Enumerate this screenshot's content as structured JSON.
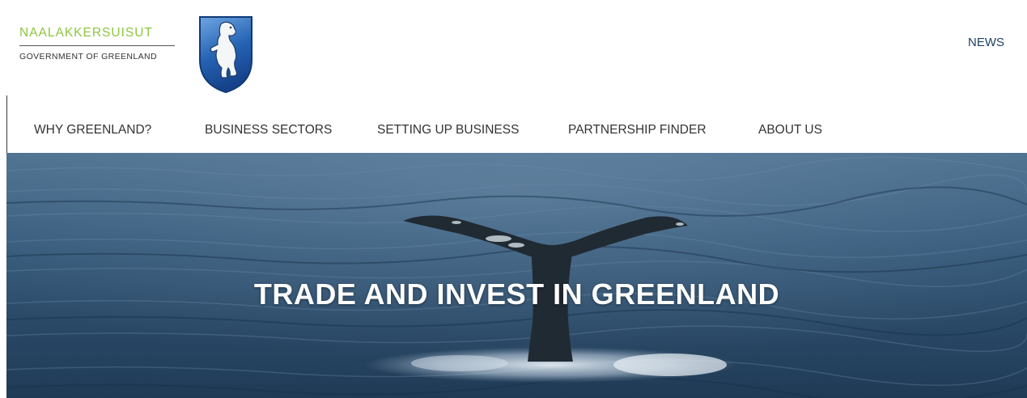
{
  "header": {
    "brand": {
      "name": "NAALAKKERSUISUT",
      "subtitle": "GOVERNMENT OF GREENLAND"
    },
    "top_links": [
      "NEWS"
    ]
  },
  "nav": {
    "items": [
      {
        "label": "WHY GREENLAND?"
      },
      {
        "label": "BUSINESS SECTORS"
      },
      {
        "label": "SETTING UP BUSINESS"
      },
      {
        "label": "PARTNERSHIP FINDER"
      },
      {
        "label": "ABOUT US"
      }
    ]
  },
  "hero": {
    "title": "TRADE AND INVEST IN GREENLAND"
  },
  "colors": {
    "brand_green": "#8dc63f",
    "shield_blue": "#1f5fae",
    "link_navy": "#1f3f66",
    "nav_text": "#333333",
    "hero_text": "#ffffff"
  },
  "icons": {
    "coat_of_arms": "polar-bear-shield-icon"
  }
}
